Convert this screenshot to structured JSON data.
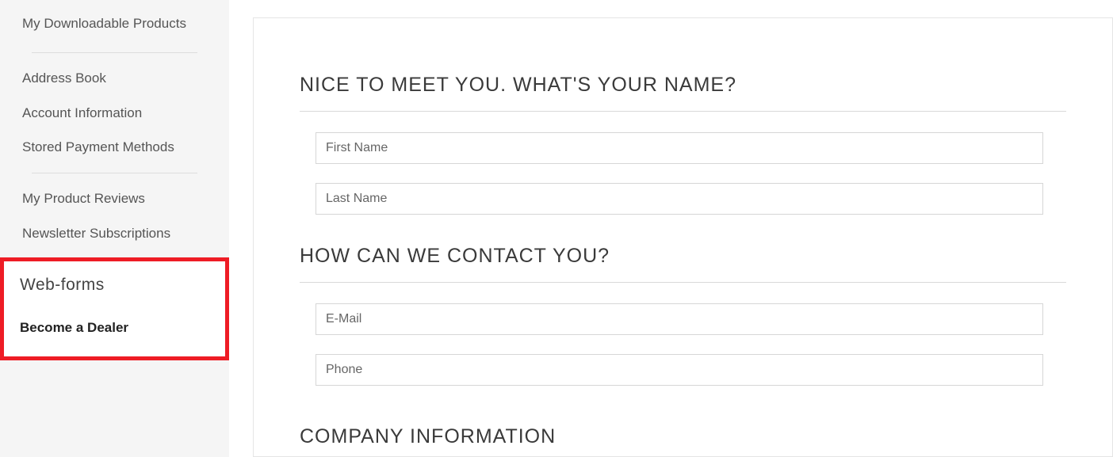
{
  "sidebar": {
    "items": [
      "My Downloadable Products",
      "Address Book",
      "Account Information",
      "Stored Payment Methods",
      "My Product Reviews",
      "Newsletter Subscriptions"
    ]
  },
  "webforms": {
    "title": "Web-forms",
    "link": "Become a Dealer"
  },
  "form": {
    "section1": "NICE TO MEET YOU. WHAT'S YOUR NAME?",
    "first_name_placeholder": "First Name",
    "last_name_placeholder": "Last Name",
    "section2": "HOW CAN WE CONTACT YOU?",
    "email_placeholder": "E-Mail",
    "phone_placeholder": "Phone",
    "section3": "COMPANY INFORMATION"
  }
}
